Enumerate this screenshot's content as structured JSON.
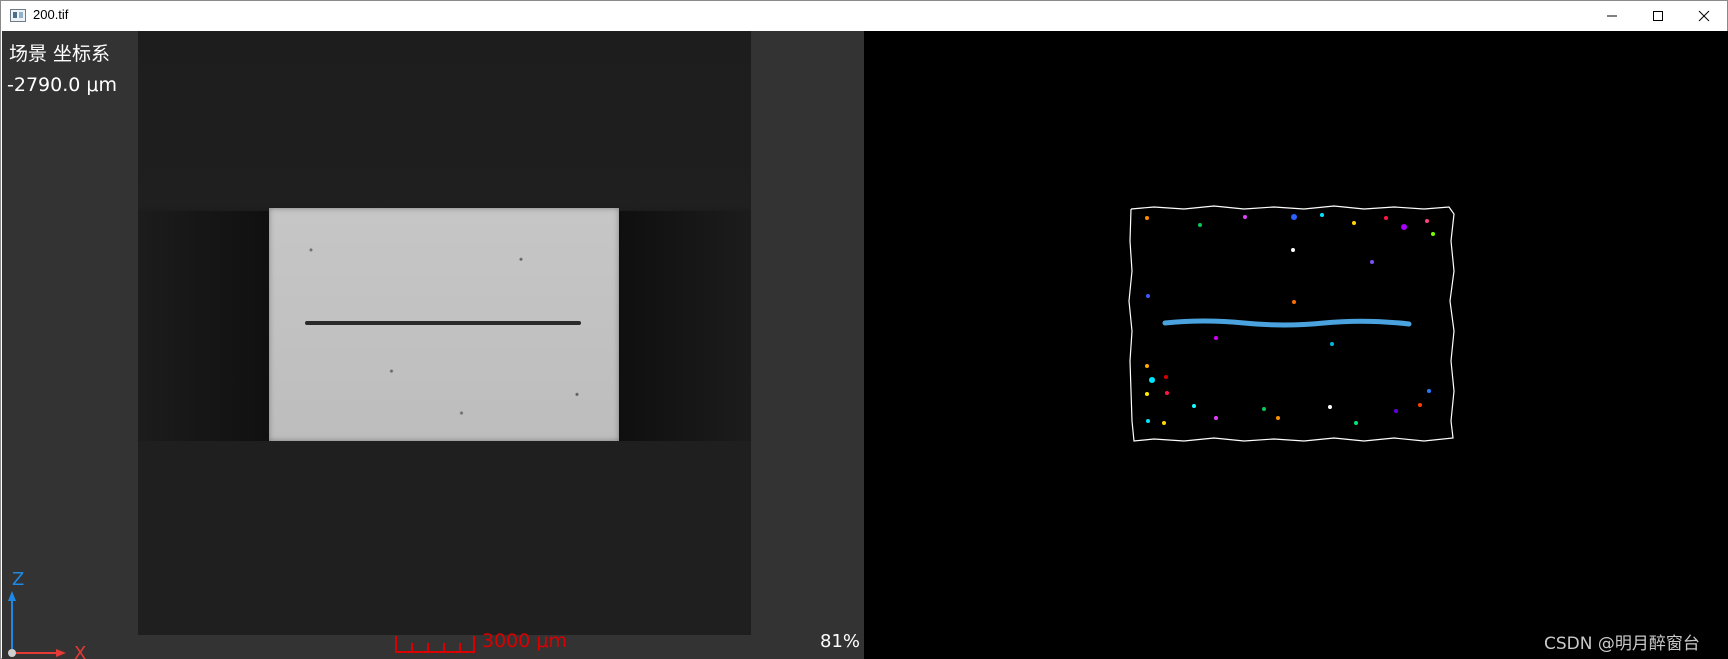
{
  "window": {
    "title": "200.tif",
    "controls": {
      "minimize_icon": "minimize-icon",
      "maximize_icon": "maximize-icon",
      "close_icon": "close-icon"
    }
  },
  "left_view": {
    "coordinate_system_label": "场景 坐标系",
    "depth_readout": "-2790.0 μm",
    "scale_bar_label": "3000 μm",
    "zoom_level": "81%",
    "axes": {
      "z_label": "Z",
      "x_label": "X"
    },
    "colors": {
      "z_axis": "#1e88e5",
      "x_axis": "#e53935",
      "scale_bar": "#d80000"
    }
  },
  "right_view": {
    "watermark": "CSDN @明月醉窗台",
    "colors": {
      "outline": "#ffffff",
      "crack": "#4aa3df",
      "background": "#000000"
    }
  }
}
